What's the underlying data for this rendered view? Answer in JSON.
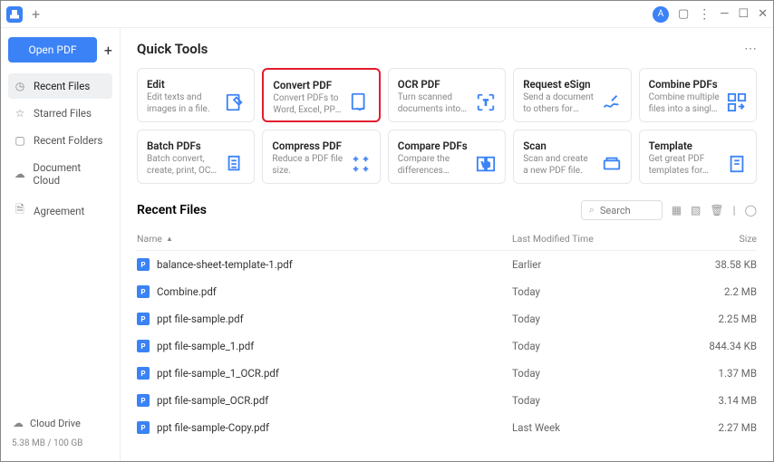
{
  "titlebar": {
    "avatar_letter": "A"
  },
  "sidebar": {
    "open_label": "Open PDF",
    "items": [
      {
        "icon": "clock",
        "label": "Recent Files",
        "active": true
      },
      {
        "icon": "star",
        "label": "Starred Files",
        "active": false
      },
      {
        "icon": "folder",
        "label": "Recent Folders",
        "active": false
      },
      {
        "icon": "cloud",
        "label": "Document Cloud",
        "active": false
      },
      {
        "icon": "doc",
        "label": "Agreement",
        "active": false
      }
    ],
    "cloud_label": "Cloud Drive",
    "storage": "5.38 MB / 100 GB"
  },
  "quick_tools": {
    "title": "Quick Tools",
    "tools": [
      {
        "title": "Edit",
        "desc": "Edit texts and images in a file.",
        "icon": "edit",
        "hl": false
      },
      {
        "title": "Convert PDF",
        "desc": "Convert PDFs to Word, Excel, PPT, etc.",
        "icon": "convert",
        "hl": true
      },
      {
        "title": "OCR PDF",
        "desc": "Turn scanned documents into searchable or editable …",
        "icon": "ocr",
        "hl": false
      },
      {
        "title": "Request eSign",
        "desc": "Send a document to others for signing.",
        "icon": "esign",
        "hl": false
      },
      {
        "title": "Combine PDFs",
        "desc": "Combine multiple files into a single PDF.",
        "icon": "combine",
        "hl": false
      },
      {
        "title": "Batch PDFs",
        "desc": "Batch convert, create, print, OCR PDFs, etc.",
        "icon": "batch",
        "hl": false
      },
      {
        "title": "Compress PDF",
        "desc": "Reduce a PDF file size.",
        "icon": "compress",
        "hl": false
      },
      {
        "title": "Compare PDFs",
        "desc": "Compare the differences between two files.",
        "icon": "compare",
        "hl": false
      },
      {
        "title": "Scan",
        "desc": "Scan and create a new PDF file.",
        "icon": "scan",
        "hl": false
      },
      {
        "title": "Template",
        "desc": "Get great PDF templates for resumes, posters, etc.",
        "icon": "template",
        "hl": false
      }
    ]
  },
  "recent": {
    "title": "Recent Files",
    "search_placeholder": "Search",
    "cols": {
      "name": "Name",
      "modified": "Last Modified Time",
      "size": "Size"
    },
    "files": [
      {
        "name": "balance-sheet-template-1.pdf",
        "modified": "Earlier",
        "size": "38.58 KB"
      },
      {
        "name": "Combine.pdf",
        "modified": "Today",
        "size": "2.2 MB"
      },
      {
        "name": "ppt file-sample.pdf",
        "modified": "Today",
        "size": "2.25 MB"
      },
      {
        "name": "ppt file-sample_1.pdf",
        "modified": "Today",
        "size": "844.34 KB"
      },
      {
        "name": "ppt file-sample_1_OCR.pdf",
        "modified": "Today",
        "size": "1.37 MB"
      },
      {
        "name": "ppt file-sample_OCR.pdf",
        "modified": "Today",
        "size": "3.14 MB"
      },
      {
        "name": "ppt file-sample-Copy.pdf",
        "modified": "Last Week",
        "size": "2.27 MB"
      }
    ]
  }
}
